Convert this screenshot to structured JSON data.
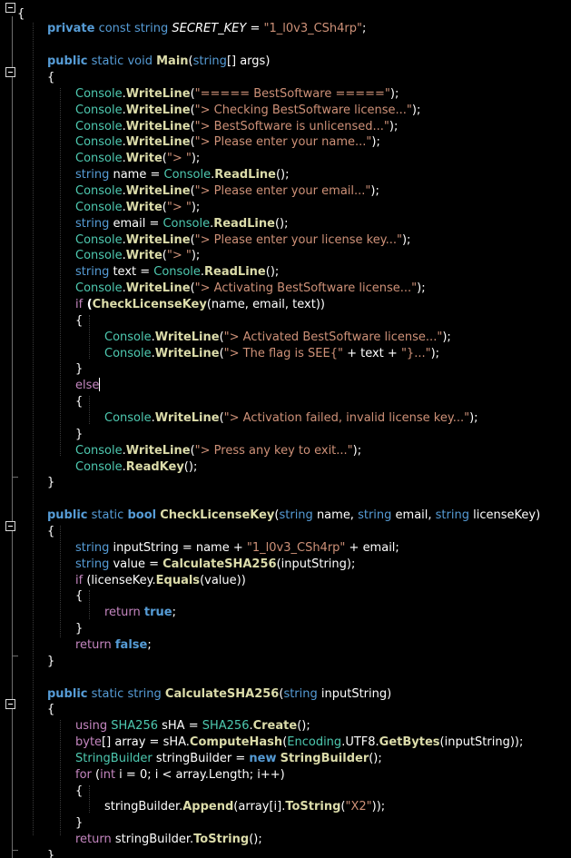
{
  "code_lines": [
    [
      {
        "t": "{",
        "c": "pl"
      }
    ],
    [
      {
        "t": "private",
        "c": "kwb"
      },
      {
        "t": " const ",
        "c": "kw"
      },
      {
        "t": "string",
        "c": "kw"
      },
      {
        "t": " ",
        "c": "pl"
      },
      {
        "t": "SECRET_KEY",
        "c": "it"
      },
      {
        "t": " = ",
        "c": "pl"
      },
      {
        "t": "\"1_l0v3_CSh4rp\"",
        "c": "str"
      },
      {
        "t": ";",
        "c": "pl"
      }
    ],
    [],
    [
      {
        "t": "public",
        "c": "kwb"
      },
      {
        "t": " static ",
        "c": "kw"
      },
      {
        "t": "void",
        "c": "kw"
      },
      {
        "t": " ",
        "c": "pl"
      },
      {
        "t": "Main",
        "c": "fn"
      },
      {
        "t": "(",
        "c": "pl"
      },
      {
        "t": "string",
        "c": "kw"
      },
      {
        "t": "[] args)",
        "c": "pl"
      }
    ],
    [
      {
        "t": "{",
        "c": "pl"
      }
    ],
    [
      {
        "t": "Console",
        "c": "ty"
      },
      {
        "t": ".",
        "c": "pl"
      },
      {
        "t": "WriteLine",
        "c": "fn"
      },
      {
        "t": "(",
        "c": "pl"
      },
      {
        "t": "\"===== BestSoftware =====\"",
        "c": "str"
      },
      {
        "t": ");",
        "c": "pl"
      }
    ],
    [
      {
        "t": "Console",
        "c": "ty"
      },
      {
        "t": ".",
        "c": "pl"
      },
      {
        "t": "WriteLine",
        "c": "fn"
      },
      {
        "t": "(",
        "c": "pl"
      },
      {
        "t": "\"> Checking BestSoftware license...\"",
        "c": "str"
      },
      {
        "t": ");",
        "c": "pl"
      }
    ],
    [
      {
        "t": "Console",
        "c": "ty"
      },
      {
        "t": ".",
        "c": "pl"
      },
      {
        "t": "WriteLine",
        "c": "fn"
      },
      {
        "t": "(",
        "c": "pl"
      },
      {
        "t": "\"> BestSoftware is unlicensed...\"",
        "c": "str"
      },
      {
        "t": ");",
        "c": "pl"
      }
    ],
    [
      {
        "t": "Console",
        "c": "ty"
      },
      {
        "t": ".",
        "c": "pl"
      },
      {
        "t": "WriteLine",
        "c": "fn"
      },
      {
        "t": "(",
        "c": "pl"
      },
      {
        "t": "\"> Please enter your name...\"",
        "c": "str"
      },
      {
        "t": ");",
        "c": "pl"
      }
    ],
    [
      {
        "t": "Console",
        "c": "ty"
      },
      {
        "t": ".",
        "c": "pl"
      },
      {
        "t": "Write",
        "c": "fn"
      },
      {
        "t": "(",
        "c": "pl"
      },
      {
        "t": "\"> \"",
        "c": "str"
      },
      {
        "t": ");",
        "c": "pl"
      }
    ],
    [
      {
        "t": "string",
        "c": "kw"
      },
      {
        "t": " name = ",
        "c": "pl"
      },
      {
        "t": "Console",
        "c": "ty"
      },
      {
        "t": ".",
        "c": "pl"
      },
      {
        "t": "ReadLine",
        "c": "fn"
      },
      {
        "t": "();",
        "c": "pl"
      }
    ],
    [
      {
        "t": "Console",
        "c": "ty"
      },
      {
        "t": ".",
        "c": "pl"
      },
      {
        "t": "WriteLine",
        "c": "fn"
      },
      {
        "t": "(",
        "c": "pl"
      },
      {
        "t": "\"> Please enter your email...\"",
        "c": "str"
      },
      {
        "t": ");",
        "c": "pl"
      }
    ],
    [
      {
        "t": "Console",
        "c": "ty"
      },
      {
        "t": ".",
        "c": "pl"
      },
      {
        "t": "Write",
        "c": "fn"
      },
      {
        "t": "(",
        "c": "pl"
      },
      {
        "t": "\"> \"",
        "c": "str"
      },
      {
        "t": ");",
        "c": "pl"
      }
    ],
    [
      {
        "t": "string",
        "c": "kw"
      },
      {
        "t": " email = ",
        "c": "pl"
      },
      {
        "t": "Console",
        "c": "ty"
      },
      {
        "t": ".",
        "c": "pl"
      },
      {
        "t": "ReadLine",
        "c": "fn"
      },
      {
        "t": "();",
        "c": "pl"
      }
    ],
    [
      {
        "t": "Console",
        "c": "ty"
      },
      {
        "t": ".",
        "c": "pl"
      },
      {
        "t": "WriteLine",
        "c": "fn"
      },
      {
        "t": "(",
        "c": "pl"
      },
      {
        "t": "\"> Please enter your license key...\"",
        "c": "str"
      },
      {
        "t": ");",
        "c": "pl"
      }
    ],
    [
      {
        "t": "Console",
        "c": "ty"
      },
      {
        "t": ".",
        "c": "pl"
      },
      {
        "t": "Write",
        "c": "fn"
      },
      {
        "t": "(",
        "c": "pl"
      },
      {
        "t": "\"> \"",
        "c": "str"
      },
      {
        "t": ");",
        "c": "pl"
      }
    ],
    [
      {
        "t": "string",
        "c": "kw"
      },
      {
        "t": " text = ",
        "c": "pl"
      },
      {
        "t": "Console",
        "c": "ty"
      },
      {
        "t": ".",
        "c": "pl"
      },
      {
        "t": "ReadLine",
        "c": "fn"
      },
      {
        "t": "();",
        "c": "pl"
      }
    ],
    [
      {
        "t": "Console",
        "c": "ty"
      },
      {
        "t": ".",
        "c": "pl"
      },
      {
        "t": "WriteLine",
        "c": "fn"
      },
      {
        "t": "(",
        "c": "pl"
      },
      {
        "t": "\"> Activating BestSoftware license...\"",
        "c": "str"
      },
      {
        "t": ");",
        "c": "pl"
      }
    ],
    [
      {
        "t": "if",
        "c": "kw2"
      },
      {
        "t": " (",
        "c": "bo"
      },
      {
        "t": "CheckLicenseKey",
        "c": "fn"
      },
      {
        "t": "(name, email, text))",
        "c": "pl"
      }
    ],
    [
      {
        "t": "{",
        "c": "pl"
      }
    ],
    [
      {
        "t": "Console",
        "c": "ty"
      },
      {
        "t": ".",
        "c": "pl"
      },
      {
        "t": "WriteLine",
        "c": "fn"
      },
      {
        "t": "(",
        "c": "pl"
      },
      {
        "t": "\"> Activated BestSoftware license...\"",
        "c": "str"
      },
      {
        "t": ");",
        "c": "pl"
      }
    ],
    [
      {
        "t": "Console",
        "c": "ty"
      },
      {
        "t": ".",
        "c": "pl"
      },
      {
        "t": "WriteLine",
        "c": "fn"
      },
      {
        "t": "(",
        "c": "pl"
      },
      {
        "t": "\"> The flag is SEE{\"",
        "c": "str"
      },
      {
        "t": " + text + ",
        "c": "pl"
      },
      {
        "t": "\"}...\"",
        "c": "str"
      },
      {
        "t": ");",
        "c": "pl"
      }
    ],
    [
      {
        "t": "}",
        "c": "pl"
      }
    ],
    [
      {
        "t": "else",
        "c": "kw2"
      }
    ],
    [
      {
        "t": "{",
        "c": "pl"
      }
    ],
    [
      {
        "t": "Console",
        "c": "ty"
      },
      {
        "t": ".",
        "c": "pl"
      },
      {
        "t": "WriteLine",
        "c": "fn"
      },
      {
        "t": "(",
        "c": "pl"
      },
      {
        "t": "\"> Activation failed, invalid license key...\"",
        "c": "str"
      },
      {
        "t": ");",
        "c": "pl"
      }
    ],
    [
      {
        "t": "}",
        "c": "pl"
      }
    ],
    [
      {
        "t": "Console",
        "c": "ty"
      },
      {
        "t": ".",
        "c": "pl"
      },
      {
        "t": "WriteLine",
        "c": "fn"
      },
      {
        "t": "(",
        "c": "pl"
      },
      {
        "t": "\"> Press any key to exit...\"",
        "c": "str"
      },
      {
        "t": ");",
        "c": "pl"
      }
    ],
    [
      {
        "t": "Console",
        "c": "ty"
      },
      {
        "t": ".",
        "c": "pl"
      },
      {
        "t": "ReadKey",
        "c": "fn"
      },
      {
        "t": "();",
        "c": "pl"
      }
    ],
    [
      {
        "t": "}",
        "c": "pl"
      }
    ],
    [],
    [
      {
        "t": "public",
        "c": "kwb"
      },
      {
        "t": " static ",
        "c": "kw"
      },
      {
        "t": "bool",
        "c": "kwb"
      },
      {
        "t": " ",
        "c": "pl"
      },
      {
        "t": "CheckLicenseKey",
        "c": "fn"
      },
      {
        "t": "(",
        "c": "pl"
      },
      {
        "t": "string",
        "c": "kw"
      },
      {
        "t": " name, ",
        "c": "pl"
      },
      {
        "t": "string",
        "c": "kw"
      },
      {
        "t": " email, ",
        "c": "pl"
      },
      {
        "t": "string",
        "c": "kw"
      },
      {
        "t": " licenseKey)",
        "c": "pl"
      }
    ],
    [
      {
        "t": "{",
        "c": "pl"
      }
    ],
    [
      {
        "t": "string",
        "c": "kw"
      },
      {
        "t": " inputString = name + ",
        "c": "pl"
      },
      {
        "t": "\"1_l0v3_CSh4rp\"",
        "c": "str"
      },
      {
        "t": " + email;",
        "c": "pl"
      }
    ],
    [
      {
        "t": "string",
        "c": "kw"
      },
      {
        "t": " value = ",
        "c": "pl"
      },
      {
        "t": "CalculateSHA256",
        "c": "fn"
      },
      {
        "t": "(inputString);",
        "c": "pl"
      }
    ],
    [
      {
        "t": "if",
        "c": "kw2"
      },
      {
        "t": " (licenseKey.",
        "c": "pl"
      },
      {
        "t": "Equals",
        "c": "fn"
      },
      {
        "t": "(value))",
        "c": "pl"
      }
    ],
    [
      {
        "t": "{",
        "c": "pl"
      }
    ],
    [
      {
        "t": "return",
        "c": "kw2"
      },
      {
        "t": " ",
        "c": "pl"
      },
      {
        "t": "true",
        "c": "kwb"
      },
      {
        "t": ";",
        "c": "pl"
      }
    ],
    [
      {
        "t": "}",
        "c": "pl"
      }
    ],
    [
      {
        "t": "return",
        "c": "kw2"
      },
      {
        "t": " ",
        "c": "pl"
      },
      {
        "t": "false",
        "c": "kwb"
      },
      {
        "t": ";",
        "c": "pl"
      }
    ],
    [
      {
        "t": "}",
        "c": "pl"
      }
    ],
    [],
    [
      {
        "t": "public",
        "c": "kwb"
      },
      {
        "t": " static ",
        "c": "kw"
      },
      {
        "t": "string",
        "c": "kw"
      },
      {
        "t": " ",
        "c": "pl"
      },
      {
        "t": "CalculateSHA256",
        "c": "fn"
      },
      {
        "t": "(",
        "c": "pl"
      },
      {
        "t": "string",
        "c": "kw"
      },
      {
        "t": " inputString)",
        "c": "pl"
      }
    ],
    [
      {
        "t": "{",
        "c": "pl"
      }
    ],
    [
      {
        "t": "using",
        "c": "kw2"
      },
      {
        "t": " ",
        "c": "pl"
      },
      {
        "t": "SHA256",
        "c": "ty"
      },
      {
        "t": " sHA = ",
        "c": "pl"
      },
      {
        "t": "SHA256",
        "c": "ty"
      },
      {
        "t": ".",
        "c": "pl"
      },
      {
        "t": "Create",
        "c": "fn"
      },
      {
        "t": "();",
        "c": "pl"
      }
    ],
    [
      {
        "t": "byte",
        "c": "kw2"
      },
      {
        "t": "[] array = sHA.",
        "c": "pl"
      },
      {
        "t": "ComputeHash",
        "c": "fn"
      },
      {
        "t": "(",
        "c": "pl"
      },
      {
        "t": "Encoding",
        "c": "ty"
      },
      {
        "t": ".UTF8.",
        "c": "pl"
      },
      {
        "t": "GetBytes",
        "c": "fn"
      },
      {
        "t": "(inputString));",
        "c": "pl"
      }
    ],
    [
      {
        "t": "StringBuilder",
        "c": "ty"
      },
      {
        "t": " stringBuilder = ",
        "c": "pl"
      },
      {
        "t": "new",
        "c": "kwb"
      },
      {
        "t": " ",
        "c": "pl"
      },
      {
        "t": "StringBuilder",
        "c": "fn"
      },
      {
        "t": "();",
        "c": "pl"
      }
    ],
    [
      {
        "t": "for",
        "c": "kw2"
      },
      {
        "t": " (",
        "c": "pl"
      },
      {
        "t": "int",
        "c": "kw2"
      },
      {
        "t": " i = 0; i < array.Length; i++)",
        "c": "pl"
      }
    ],
    [
      {
        "t": "{",
        "c": "pl"
      }
    ],
    [
      {
        "t": "stringBuilder.",
        "c": "pl"
      },
      {
        "t": "Append",
        "c": "fn"
      },
      {
        "t": "(array[i].",
        "c": "pl"
      },
      {
        "t": "ToString",
        "c": "fn"
      },
      {
        "t": "(",
        "c": "pl"
      },
      {
        "t": "\"X2\"",
        "c": "str"
      },
      {
        "t": "));",
        "c": "pl"
      }
    ],
    [
      {
        "t": "}",
        "c": "pl"
      }
    ],
    [
      {
        "t": "return",
        "c": "kw2"
      },
      {
        "t": " stringBuilder.",
        "c": "pl"
      },
      {
        "t": "ToString",
        "c": "fn"
      },
      {
        "t": "();",
        "c": "pl"
      }
    ],
    [
      {
        "t": "}",
        "c": "pl"
      }
    ]
  ],
  "colors": {
    "background": "#000000",
    "keyword": "#569cd6",
    "control_keyword": "#c586c0",
    "type": "#4ec9b0",
    "string": "#ce9178",
    "method": "#dcdcaa",
    "plain": "#ffffff"
  },
  "icons": {
    "fold_marker": "collapse-minus-icon"
  }
}
